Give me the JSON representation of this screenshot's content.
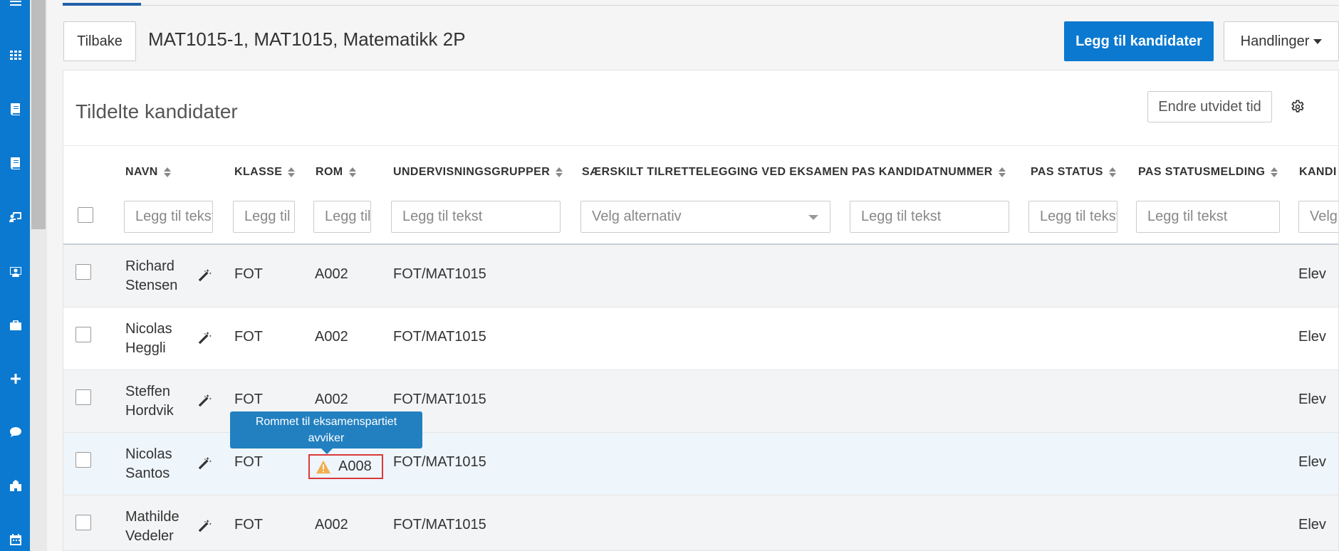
{
  "rail": {
    "icons": [
      "menu-icon",
      "apps-grid-icon",
      "book-icon",
      "book-alt-icon",
      "teacher-board-icon",
      "student-icon",
      "briefcase-icon",
      "plus-icon",
      "chat-icon",
      "school-icon",
      "calendar-icon"
    ]
  },
  "header": {
    "back_label": "Tilbake",
    "title": "MAT1015-1, MAT1015, Matematikk 2P",
    "add_label": "Legg til kandidater",
    "actions_label": "Handlinger"
  },
  "panel": {
    "title": "Tildelte kandidater",
    "extend_time_label": "Endre utvidet tid"
  },
  "columns": [
    {
      "label": "NAVN",
      "sortable": true
    },
    {
      "label": "KLASSE",
      "sortable": true
    },
    {
      "label": "ROM",
      "sortable": true
    },
    {
      "label": "UNDERVISNINGSGRUPPER",
      "sortable": true
    },
    {
      "label": "SÆRSKILT TILRETTELEGGING VED EKSAMEN",
      "sortable": false
    },
    {
      "label": "PAS KANDIDATNUMMER",
      "sortable": true
    },
    {
      "label": "PAS STATUS",
      "sortable": true
    },
    {
      "label": "PAS STATUSMELDING",
      "sortable": true
    },
    {
      "label": "KANDI",
      "sortable": false
    }
  ],
  "filters": {
    "navn": "Legg til tekst",
    "klasse": "Legg til tekst",
    "rom": "Legg til tekst",
    "undervisningsgrupper": "Legg til tekst",
    "tilrettelegging": "Velg alternativ",
    "kandidatnummer": "Legg til tekst",
    "status": "Legg til tekst",
    "statusmelding": "Legg til tekst",
    "kandi": "Velg alternativ"
  },
  "rows": [
    {
      "first": "Richard",
      "last": "Stensen",
      "klasse": "FOT",
      "rom": "A002",
      "gruppe": "FOT/MAT1015",
      "kandi": "Elev",
      "warning": false
    },
    {
      "first": "Nicolas",
      "last": "Heggli",
      "klasse": "FOT",
      "rom": "A002",
      "gruppe": "FOT/MAT1015",
      "kandi": "Elev",
      "warning": false
    },
    {
      "first": "Steffen",
      "last": "Hordvik",
      "klasse": "FOT",
      "rom": "A002",
      "gruppe": "FOT/MAT1015",
      "kandi": "Elev",
      "warning": false
    },
    {
      "first": "Nicolas",
      "last": "Santos",
      "klasse": "FOT",
      "rom": "A008",
      "gruppe": "FOT/MAT1015",
      "kandi": "Elev",
      "warning": true
    },
    {
      "first": "Mathilde",
      "last": "Vedeler",
      "klasse": "FOT",
      "rom": "A002",
      "gruppe": "FOT/MAT1015",
      "kandi": "Elev",
      "warning": false
    }
  ],
  "tooltip": {
    "line1": "Rommet til eksamenspartiet",
    "line2": "avviker"
  },
  "colors": {
    "brand": "#0b79d0",
    "tooltip": "#2280c0",
    "warning": "#f0ad4e",
    "warning_border": "#d93a3a"
  }
}
